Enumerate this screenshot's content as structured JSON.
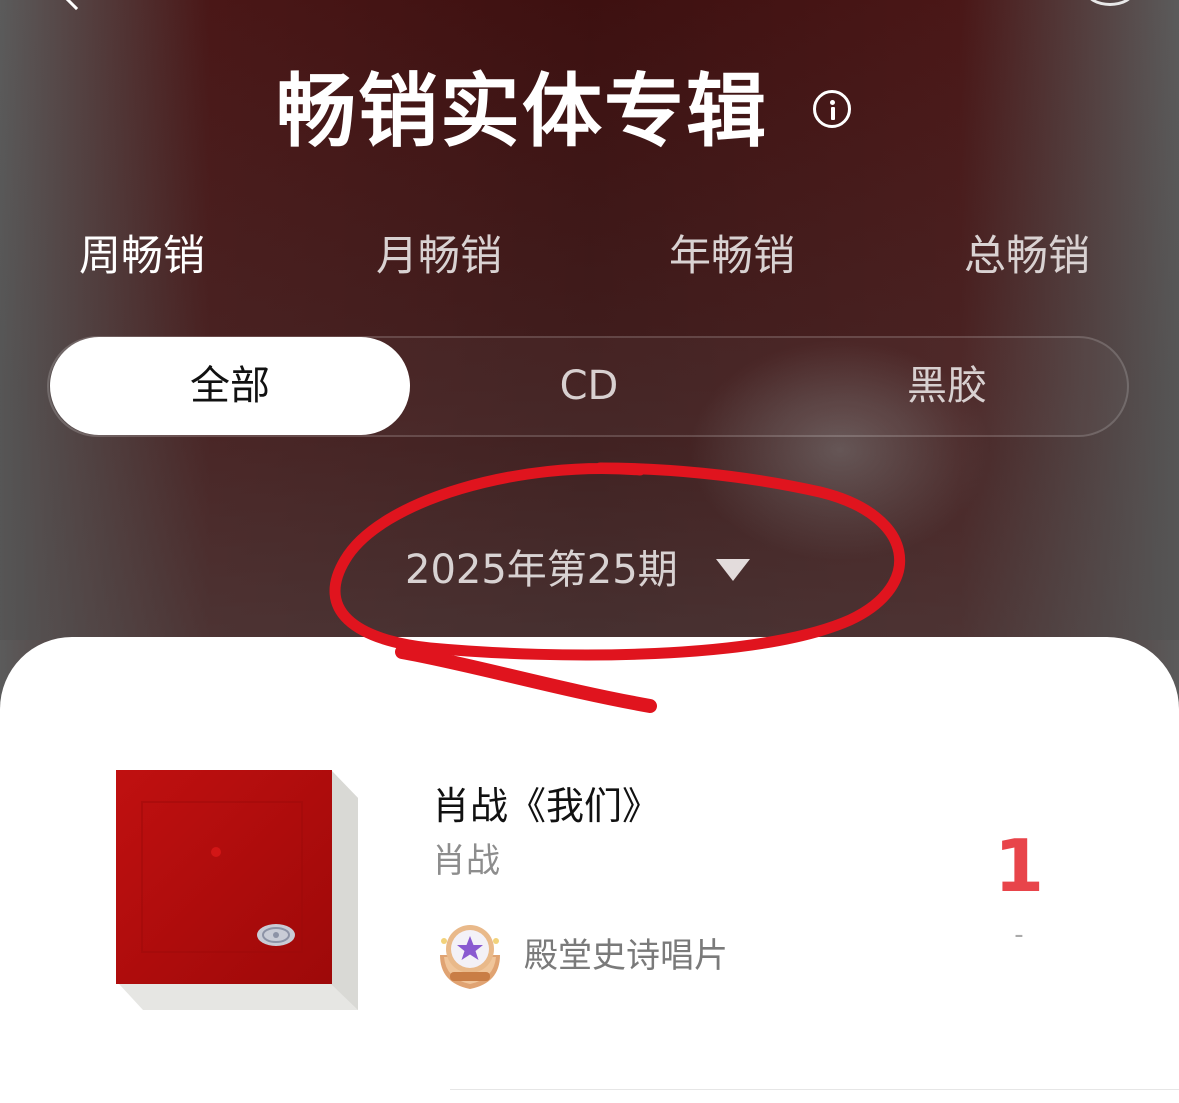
{
  "page": {
    "title": "畅销实体专辑"
  },
  "period_tabs": [
    {
      "label": "周畅销",
      "active": true
    },
    {
      "label": "月畅销",
      "active": false
    },
    {
      "label": "年畅销",
      "active": false
    },
    {
      "label": "总畅销",
      "active": false
    }
  ],
  "format_tabs": [
    {
      "label": "全部",
      "active": true
    },
    {
      "label": "CD",
      "active": false
    },
    {
      "label": "黑胶",
      "active": false
    }
  ],
  "issue_selector": {
    "label": "2025年第25期",
    "icon": "caret-down-icon"
  },
  "chart_entries": [
    {
      "title": "肖战《我们》",
      "artist": "肖战",
      "badge_label": "殿堂史诗唱片",
      "rank": "1",
      "rank_change": "-"
    }
  ],
  "icons": {
    "info": "info-icon",
    "back": "chevron-left-icon",
    "badge": "award-badge-icon"
  },
  "colors": {
    "header_background": "#3d1010",
    "accent_red": "#e8444a",
    "annotation_red": "#e0141e",
    "album_red": "#b50d0d"
  }
}
